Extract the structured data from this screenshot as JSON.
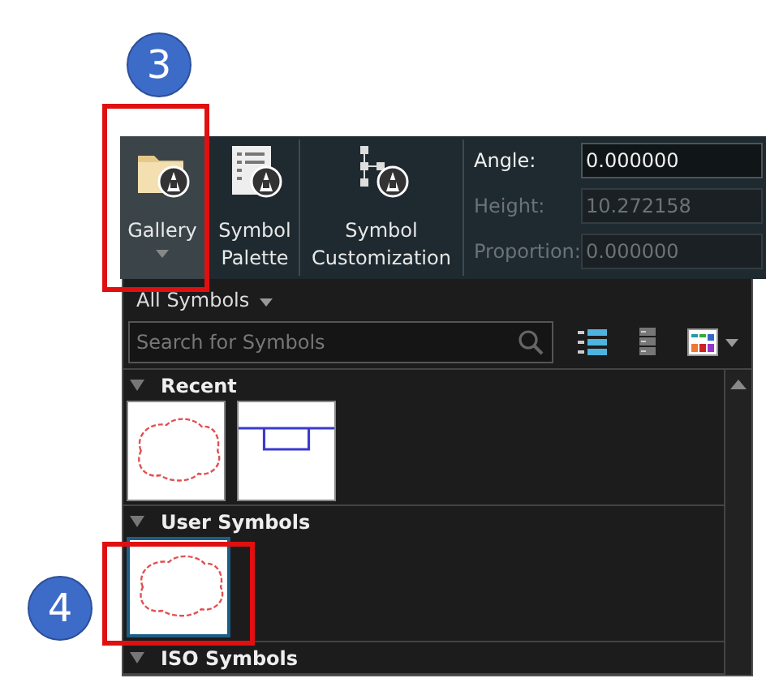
{
  "ribbon": {
    "buttons": [
      {
        "kind": "gallery",
        "label": "Gallery",
        "selected": true,
        "dropdown": true
      },
      {
        "kind": "palette",
        "label": "Symbol Palette",
        "selected": false,
        "dropdown": false
      },
      {
        "kind": "custom",
        "label": "Symbol Customization",
        "selected": false,
        "dropdown": false
      }
    ],
    "fields": [
      {
        "label": "Angle:",
        "value": "0.000000",
        "disabled": false
      },
      {
        "label": "Height:",
        "value": "10.272158",
        "disabled": true
      },
      {
        "label": "Proportion:",
        "value": "0.000000",
        "disabled": true
      }
    ]
  },
  "gallery_panel": {
    "filter": "All Symbols",
    "search": {
      "placeholder": "Search for Symbols"
    },
    "sections": [
      {
        "title": "Recent",
        "expanded": true,
        "symbols": [
          {
            "kind": "cloud",
            "selected": false
          },
          {
            "kind": "weld",
            "selected": false
          }
        ]
      },
      {
        "title": "User Symbols",
        "expanded": true,
        "symbols": [
          {
            "kind": "cloud",
            "selected": true
          }
        ]
      },
      {
        "title": "ISO Symbols",
        "expanded": true
      }
    ]
  },
  "callouts": [
    {
      "number": "3"
    },
    {
      "number": "4"
    }
  ]
}
